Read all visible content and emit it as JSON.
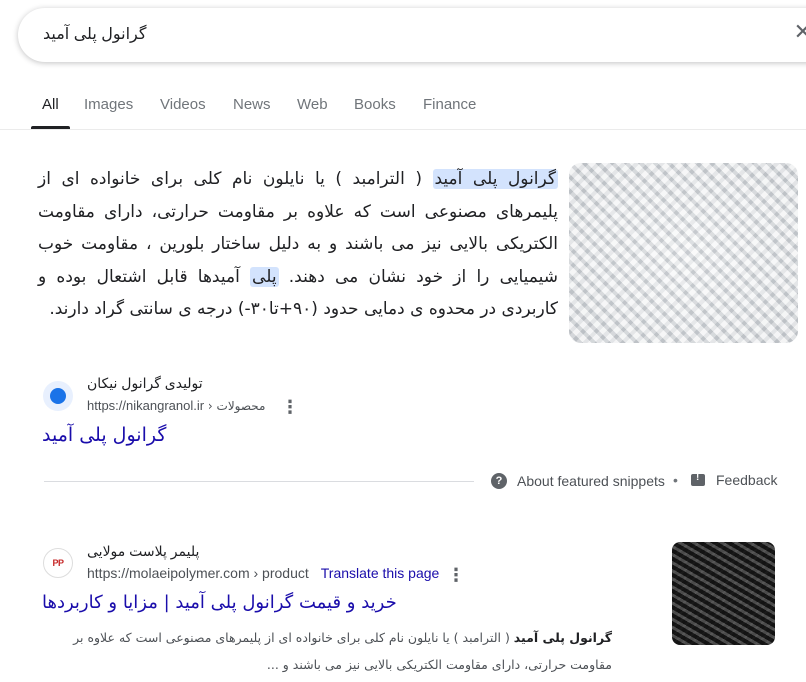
{
  "search": {
    "query": "گرانول پلی آمید",
    "clear_icon": "close-icon"
  },
  "tabs": [
    "All",
    "Images",
    "Videos",
    "News",
    "Web",
    "Books",
    "Finance"
  ],
  "snippet": {
    "hl1": "گرانول پلی آمید",
    "text1": " ( الترامبد ) یا نایلون نام کلی برای خانواده ای از پلیمرهای مصنوعی است که علاوه بر مقاومت حرارتی، دارای مقاومت الکتریکی بالایی نیز می باشند و به دلیل ساختار بلورین ، مقاومت خوب شیمیایی را از خود نشان می دهند. ",
    "hl2": "پلی",
    "text2": " آمیدها قابل اشتعال بوده و کاربردی در محدوه ی دمایی حدود (۹۰+تا۳۰-) درجه ی سانتی گراد دارند.",
    "source_name": "تولیدی گرانول نیکان",
    "source_url": "https://nikangranol.ir",
    "source_path": " › محصولات",
    "result_title": "گرانول پلی آمید",
    "about_label": "About featured snippets",
    "feedback_label": "Feedback"
  },
  "result2": {
    "source_name": "پلیمر پلاست مولایی",
    "source_url": "https://molaeipolymer.com › product",
    "translate_label": "Translate this page",
    "title": "خرید و قیمت گرانول پلی آمید | مزایا و کاربردها",
    "desc_bold": "گرانول پلی آمید",
    "desc": " ( الترامبد ) یا نایلون نام کلی برای خانواده ای از پلیمرهای مصنوعی است که علاوه بر مقاومت حرارتی، دارای مقاومت الکتریکی بالایی نیز می باشند و ..."
  },
  "colors": {
    "link": "#1a0dab",
    "highlight": "#d3e3fd",
    "text": "#202124",
    "muted": "#4d5156"
  }
}
